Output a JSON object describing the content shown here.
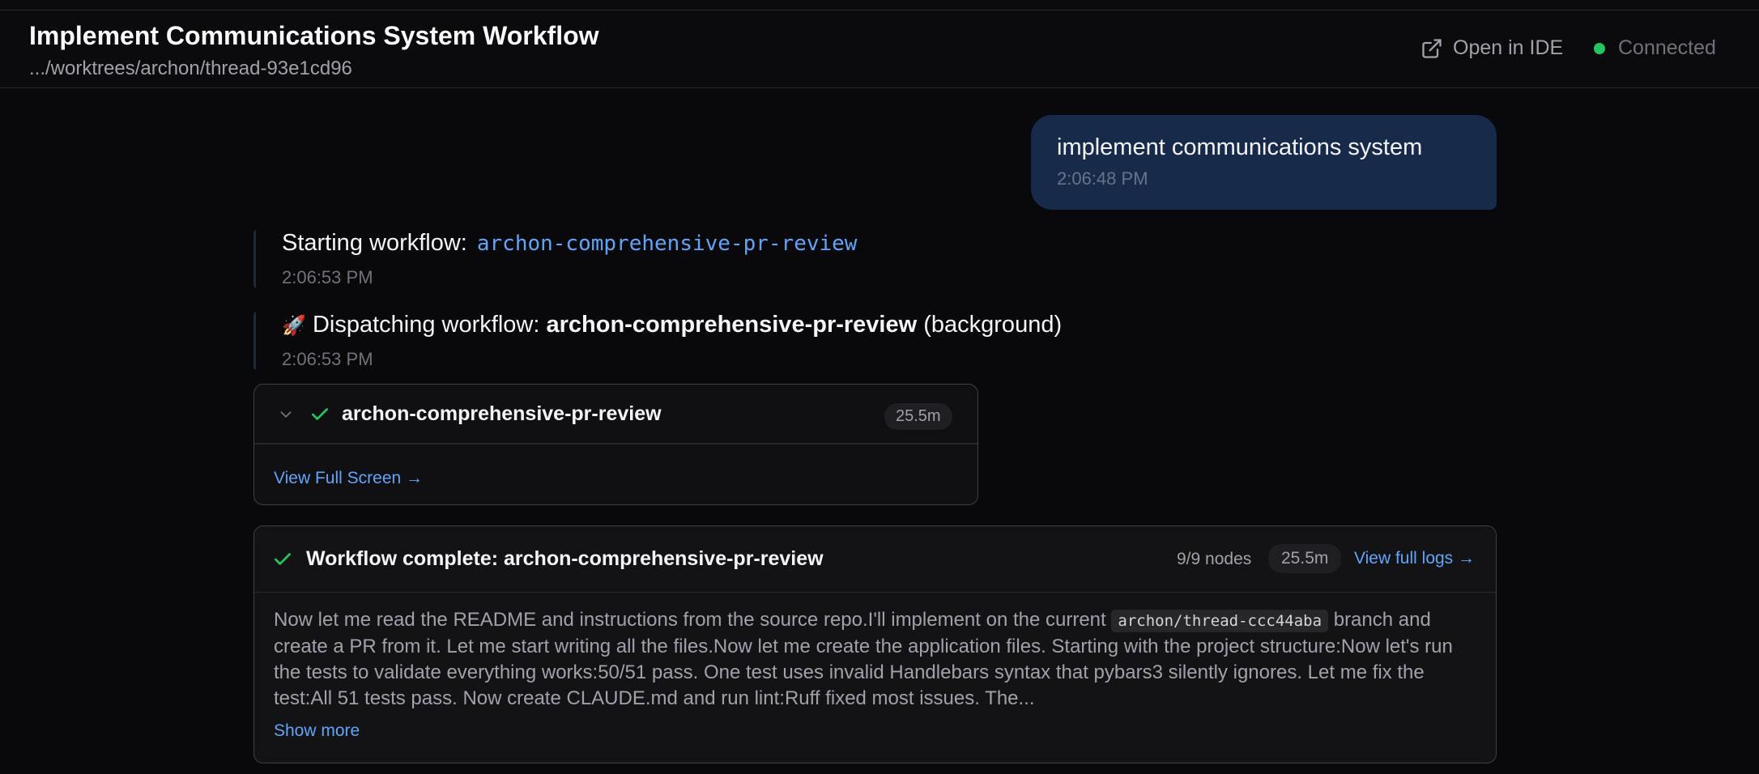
{
  "header": {
    "title": "Implement Communications System Workflow",
    "path": ".../worktrees/archon/thread-93e1cd96",
    "open_ide_label": "Open in IDE",
    "status_label": "Connected",
    "status_color": "#22c55e"
  },
  "messages": {
    "user": {
      "text": "implement communications system",
      "time": "2:06:48 PM"
    },
    "starting": {
      "prefix": "Starting workflow:",
      "workflow": "archon-comprehensive-pr-review",
      "time": "2:06:53 PM"
    },
    "dispatching": {
      "emoji": "🚀",
      "prefix": "Dispatching workflow:",
      "workflow": "archon-comprehensive-pr-review",
      "suffix": "(background)",
      "time": "2:06:53 PM"
    }
  },
  "workflow_card": {
    "name": "archon-comprehensive-pr-review",
    "duration": "25.5m",
    "view_full_screen": "View Full Screen →"
  },
  "complete_card": {
    "title": "Workflow complete: archon-comprehensive-pr-review",
    "nodes": "9/9 nodes",
    "duration": "25.5m",
    "view_logs": "View full logs →",
    "body_start": "Now let me read the README and instructions from the source repo.I'll implement on the current ",
    "branch": "archon/thread-ccc44aba",
    "body_rest": " branch and create a PR from it. Let me start writing all the files.Now let me create the application files. Starting with the project structure:Now let's run the tests to validate everything works:50/51 pass. One test uses invalid Handlebars syntax that pybars3 silently ignores. Let me fix the test:All 51 tests pass. Now create CLAUDE.md and run lint:Ruff fixed most issues. The...",
    "show_more": "Show more"
  },
  "icons": {
    "open_ide": "external-link-icon",
    "status": "status-dot-icon",
    "chevron": "chevron-down-icon",
    "check": "check-icon"
  },
  "colors": {
    "accent": "#60a5fa",
    "success": "#22c55e",
    "user_bubble": "#172a4a"
  }
}
